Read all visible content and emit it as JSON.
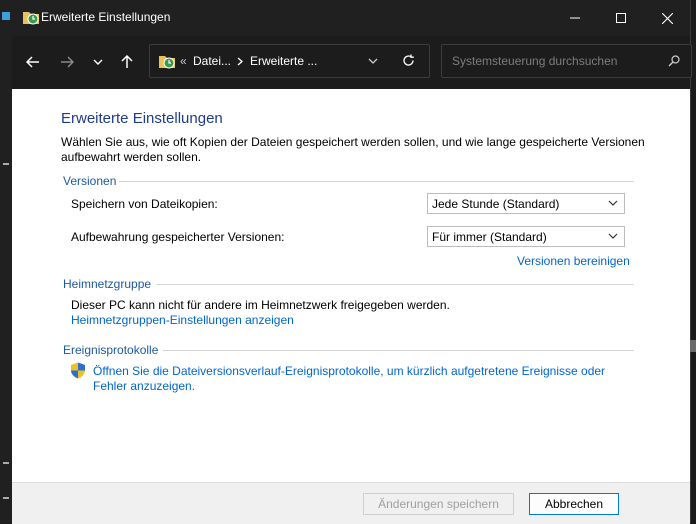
{
  "window": {
    "title": "Erweiterte Einstellungen"
  },
  "address": {
    "crumb1": "Datei...",
    "crumb2": "Erweiterte ...",
    "prefix": "«"
  },
  "search": {
    "placeholder": "Systemsteuerung durchsuchen"
  },
  "page": {
    "heading": "Erweiterte Einstellungen",
    "description": "Wählen Sie aus, wie oft Kopien der Dateien gespeichert werden sollen, und wie lange gespeicherte Versionen aufbewahrt werden sollen."
  },
  "versions": {
    "section_title": "Versionen",
    "save_label": "Speichern von Dateikopien:",
    "save_value": "Jede Stunde (Standard)",
    "keep_label": "Aufbewahrung gespeicherter Versionen:",
    "keep_value": "Für immer (Standard)",
    "cleanup_link": "Versionen bereinigen"
  },
  "homegroup": {
    "section_title": "Heimnetzgruppe",
    "text": "Dieser PC kann nicht für andere im Heimnetzwerk freigegeben werden.",
    "link": "Heimnetzgruppen-Einstellungen anzeigen"
  },
  "eventlog": {
    "section_title": "Ereignisprotokolle",
    "link": "Öffnen Sie die Dateiversionsverlauf-Ereignisprotokolle, um kürzlich aufgetretene Ereignisse oder Fehler anzuzeigen."
  },
  "footer": {
    "save_button": "Änderungen speichern",
    "cancel_button": "Abbrechen"
  },
  "colors": {
    "heading": "#1e3c8c",
    "section": "#1e5aa0",
    "link": "#0066cc",
    "titlebar": "#202020"
  },
  "icons": [
    "folder-history-icon",
    "minimize-icon",
    "maximize-icon",
    "close-icon",
    "back-arrow-icon",
    "forward-arrow-icon",
    "chevron-down-icon",
    "up-arrow-icon",
    "refresh-icon",
    "search-icon",
    "shield-icon"
  ]
}
